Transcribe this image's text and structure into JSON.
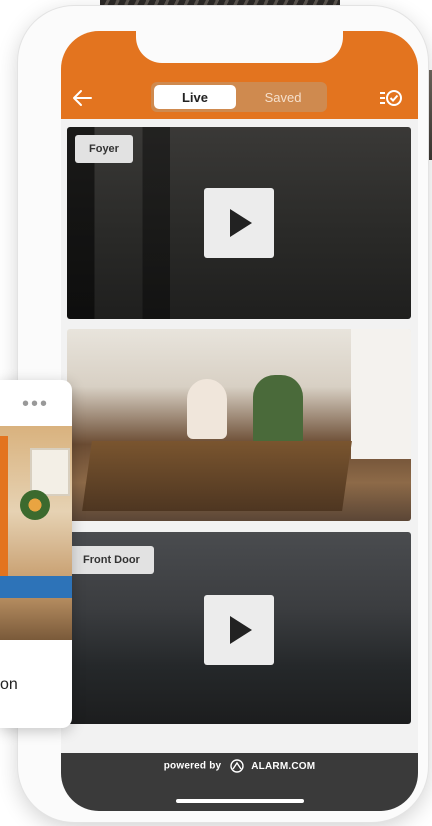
{
  "header": {
    "tabs": [
      {
        "label": "Live",
        "active": true
      },
      {
        "label": "Saved",
        "active": false
      }
    ],
    "accent_color": "#e3741f",
    "back_icon": "arrow-left-icon",
    "right_icon": "list-check-icon"
  },
  "cameras": [
    {
      "label": "Foyer",
      "state": "paused",
      "icon": "play-icon"
    },
    {
      "label": "",
      "state": "playing"
    },
    {
      "label": "Front Door",
      "state": "paused",
      "icon": "play-icon"
    }
  ],
  "footer": {
    "powered_by": "powered by",
    "brand": "ALARM.COM"
  },
  "card": {
    "menu_icon": "more-horizontal-icon",
    "text": "on"
  }
}
